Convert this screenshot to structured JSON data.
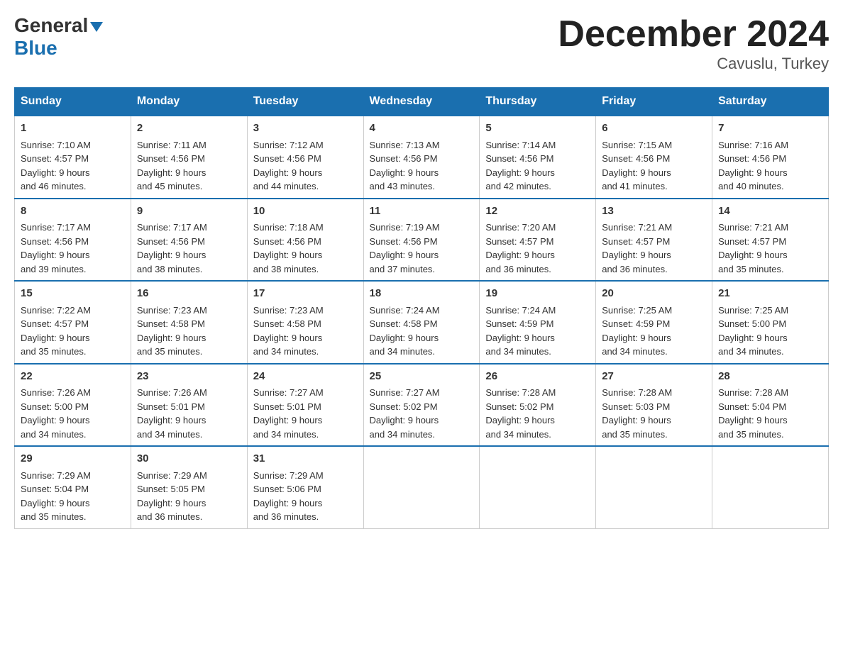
{
  "header": {
    "logo_general": "General",
    "logo_blue": "Blue",
    "month_title": "December 2024",
    "location": "Cavuslu, Turkey"
  },
  "days_of_week": [
    "Sunday",
    "Monday",
    "Tuesday",
    "Wednesday",
    "Thursday",
    "Friday",
    "Saturday"
  ],
  "weeks": [
    [
      {
        "day": 1,
        "sunrise": "7:10 AM",
        "sunset": "4:57 PM",
        "daylight": "9 hours and 46 minutes."
      },
      {
        "day": 2,
        "sunrise": "7:11 AM",
        "sunset": "4:56 PM",
        "daylight": "9 hours and 45 minutes."
      },
      {
        "day": 3,
        "sunrise": "7:12 AM",
        "sunset": "4:56 PM",
        "daylight": "9 hours and 44 minutes."
      },
      {
        "day": 4,
        "sunrise": "7:13 AM",
        "sunset": "4:56 PM",
        "daylight": "9 hours and 43 minutes."
      },
      {
        "day": 5,
        "sunrise": "7:14 AM",
        "sunset": "4:56 PM",
        "daylight": "9 hours and 42 minutes."
      },
      {
        "day": 6,
        "sunrise": "7:15 AM",
        "sunset": "4:56 PM",
        "daylight": "9 hours and 41 minutes."
      },
      {
        "day": 7,
        "sunrise": "7:16 AM",
        "sunset": "4:56 PM",
        "daylight": "9 hours and 40 minutes."
      }
    ],
    [
      {
        "day": 8,
        "sunrise": "7:17 AM",
        "sunset": "4:56 PM",
        "daylight": "9 hours and 39 minutes."
      },
      {
        "day": 9,
        "sunrise": "7:17 AM",
        "sunset": "4:56 PM",
        "daylight": "9 hours and 38 minutes."
      },
      {
        "day": 10,
        "sunrise": "7:18 AM",
        "sunset": "4:56 PM",
        "daylight": "9 hours and 38 minutes."
      },
      {
        "day": 11,
        "sunrise": "7:19 AM",
        "sunset": "4:56 PM",
        "daylight": "9 hours and 37 minutes."
      },
      {
        "day": 12,
        "sunrise": "7:20 AM",
        "sunset": "4:57 PM",
        "daylight": "9 hours and 36 minutes."
      },
      {
        "day": 13,
        "sunrise": "7:21 AM",
        "sunset": "4:57 PM",
        "daylight": "9 hours and 36 minutes."
      },
      {
        "day": 14,
        "sunrise": "7:21 AM",
        "sunset": "4:57 PM",
        "daylight": "9 hours and 35 minutes."
      }
    ],
    [
      {
        "day": 15,
        "sunrise": "7:22 AM",
        "sunset": "4:57 PM",
        "daylight": "9 hours and 35 minutes."
      },
      {
        "day": 16,
        "sunrise": "7:23 AM",
        "sunset": "4:58 PM",
        "daylight": "9 hours and 35 minutes."
      },
      {
        "day": 17,
        "sunrise": "7:23 AM",
        "sunset": "4:58 PM",
        "daylight": "9 hours and 34 minutes."
      },
      {
        "day": 18,
        "sunrise": "7:24 AM",
        "sunset": "4:58 PM",
        "daylight": "9 hours and 34 minutes."
      },
      {
        "day": 19,
        "sunrise": "7:24 AM",
        "sunset": "4:59 PM",
        "daylight": "9 hours and 34 minutes."
      },
      {
        "day": 20,
        "sunrise": "7:25 AM",
        "sunset": "4:59 PM",
        "daylight": "9 hours and 34 minutes."
      },
      {
        "day": 21,
        "sunrise": "7:25 AM",
        "sunset": "5:00 PM",
        "daylight": "9 hours and 34 minutes."
      }
    ],
    [
      {
        "day": 22,
        "sunrise": "7:26 AM",
        "sunset": "5:00 PM",
        "daylight": "9 hours and 34 minutes."
      },
      {
        "day": 23,
        "sunrise": "7:26 AM",
        "sunset": "5:01 PM",
        "daylight": "9 hours and 34 minutes."
      },
      {
        "day": 24,
        "sunrise": "7:27 AM",
        "sunset": "5:01 PM",
        "daylight": "9 hours and 34 minutes."
      },
      {
        "day": 25,
        "sunrise": "7:27 AM",
        "sunset": "5:02 PM",
        "daylight": "9 hours and 34 minutes."
      },
      {
        "day": 26,
        "sunrise": "7:28 AM",
        "sunset": "5:02 PM",
        "daylight": "9 hours and 34 minutes."
      },
      {
        "day": 27,
        "sunrise": "7:28 AM",
        "sunset": "5:03 PM",
        "daylight": "9 hours and 35 minutes."
      },
      {
        "day": 28,
        "sunrise": "7:28 AM",
        "sunset": "5:04 PM",
        "daylight": "9 hours and 35 minutes."
      }
    ],
    [
      {
        "day": 29,
        "sunrise": "7:29 AM",
        "sunset": "5:04 PM",
        "daylight": "9 hours and 35 minutes."
      },
      {
        "day": 30,
        "sunrise": "7:29 AM",
        "sunset": "5:05 PM",
        "daylight": "9 hours and 36 minutes."
      },
      {
        "day": 31,
        "sunrise": "7:29 AM",
        "sunset": "5:06 PM",
        "daylight": "9 hours and 36 minutes."
      },
      null,
      null,
      null,
      null
    ]
  ]
}
